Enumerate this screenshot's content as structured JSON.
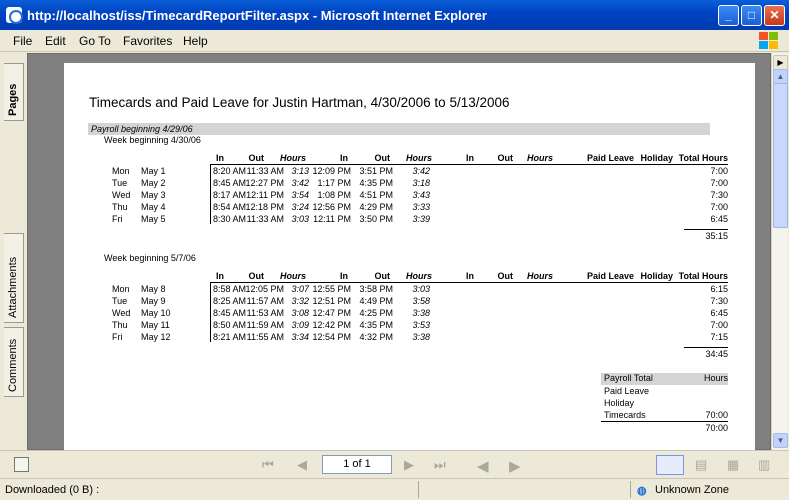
{
  "window": {
    "title": "http://localhost/iss/TimecardReportFilter.aspx - Microsoft Internet Explorer"
  },
  "menu": [
    "File",
    "Edit",
    "Go To",
    "Favorites",
    "Help"
  ],
  "side_tabs": [
    "Pages",
    "Attachments",
    "Comments"
  ],
  "report": {
    "title": "Timecards and Paid Leave for Justin Hartman, 4/30/2006 to 5/13/2006",
    "payroll_label": "Payroll beginning 4/29/06",
    "headers": [
      "In",
      "Out",
      "Hours",
      "In",
      "Out",
      "Hours",
      "In",
      "Out",
      "Hours",
      "Paid Leave",
      "Holiday",
      "Total Hours"
    ],
    "weeks": [
      {
        "label": "Week beginning 4/30/06",
        "rows": [
          {
            "day": "Mon",
            "date": "May 1",
            "in1": "8:20 AM",
            "out1": "11:33 AM",
            "h1": "3:13",
            "in2": "12:09 PM",
            "out2": "3:51 PM",
            "h2": "3:42",
            "total": "7:00"
          },
          {
            "day": "Tue",
            "date": "May 2",
            "in1": "8:45 AM",
            "out1": "12:27 PM",
            "h1": "3:42",
            "in2": "1:17 PM",
            "out2": "4:35 PM",
            "h2": "3:18",
            "total": "7:00"
          },
          {
            "day": "Wed",
            "date": "May 3",
            "in1": "8:17 AM",
            "out1": "12:11 PM",
            "h1": "3:54",
            "in2": "1:08 PM",
            "out2": "4:51 PM",
            "h2": "3:43",
            "total": "7:30"
          },
          {
            "day": "Thu",
            "date": "May 4",
            "in1": "8:54 AM",
            "out1": "12:18 PM",
            "h1": "3:24",
            "in2": "12:56 PM",
            "out2": "4:29 PM",
            "h2": "3:33",
            "total": "7:00"
          },
          {
            "day": "Fri",
            "date": "May 5",
            "in1": "8:30 AM",
            "out1": "11:33 AM",
            "h1": "3:03",
            "in2": "12:11 PM",
            "out2": "3:50 PM",
            "h2": "3:39",
            "total": "6:45"
          }
        ],
        "week_total": "35:15"
      },
      {
        "label": "Week beginning 5/7/06",
        "rows": [
          {
            "day": "Mon",
            "date": "May 8",
            "in1": "8:58 AM",
            "out1": "12:05 PM",
            "h1": "3:07",
            "in2": "12:55 PM",
            "out2": "3:58 PM",
            "h2": "3:03",
            "total": "6:15"
          },
          {
            "day": "Tue",
            "date": "May 9",
            "in1": "8:25 AM",
            "out1": "11:57 AM",
            "h1": "3:32",
            "in2": "12:51 PM",
            "out2": "4:49 PM",
            "h2": "3:58",
            "total": "7:30"
          },
          {
            "day": "Wed",
            "date": "May 10",
            "in1": "8:45 AM",
            "out1": "11:53 AM",
            "h1": "3:08",
            "in2": "12:47 PM",
            "out2": "4:25 PM",
            "h2": "3:38",
            "total": "6:45"
          },
          {
            "day": "Thu",
            "date": "May 11",
            "in1": "8:50 AM",
            "out1": "11:59 AM",
            "h1": "3:09",
            "in2": "12:42 PM",
            "out2": "4:35 PM",
            "h2": "3:53",
            "total": "7:00"
          },
          {
            "day": "Fri",
            "date": "May 12",
            "in1": "8:21 AM",
            "out1": "11:55 AM",
            "h1": "3:34",
            "in2": "12:54 PM",
            "out2": "4:32 PM",
            "h2": "3:38",
            "total": "7:15"
          }
        ],
        "week_total": "34:45"
      }
    ],
    "summary": {
      "label": "Payroll Total",
      "hours_label": "Hours",
      "rows": [
        {
          "label": "Paid Leave",
          "value": ""
        },
        {
          "label": "Holiday",
          "value": ""
        },
        {
          "label": "Timecards",
          "value": "70:00"
        }
      ],
      "total": "70:00"
    }
  },
  "navigation": {
    "page_indicator": "1 of 1"
  },
  "status": {
    "left": "Downloaded  (0 B) :",
    "zone": "Unknown Zone"
  }
}
